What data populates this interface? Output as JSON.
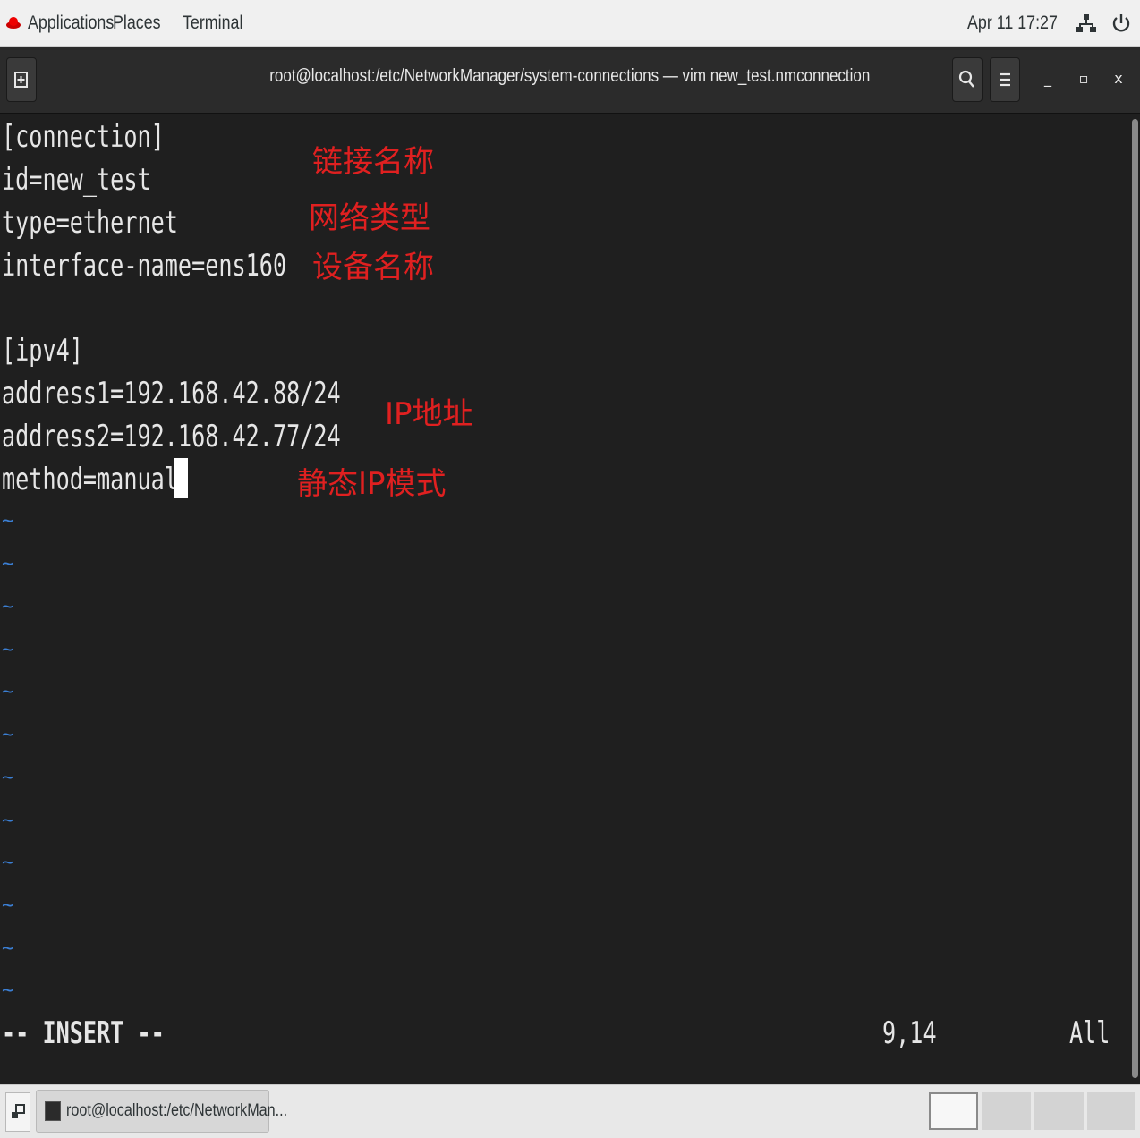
{
  "topbar": {
    "applications": "Applications",
    "places": "Places",
    "terminal": "Terminal",
    "clock": "Apr 11  17:27",
    "icons": [
      "redhat-logo-icon",
      "network-icon",
      "power-icon"
    ]
  },
  "window": {
    "title": "root@localhost:/etc/NetworkManager/system-connections — vim new_test.nmconnection",
    "buttons": [
      "new-tab-icon",
      "search-icon",
      "menu-icon",
      "minimize-icon",
      "maximize-icon",
      "close-icon"
    ],
    "minimize_glyph": "_",
    "maximize_glyph": "▫",
    "close_glyph": "x"
  },
  "editor": {
    "lines": [
      "[connection]",
      "id=new_test",
      "type=ethernet",
      "interface-name=ens160",
      "",
      "[ipv4]",
      "address1=192.168.42.88/24",
      "address2=192.168.42.77/24",
      "method=manual"
    ],
    "tilde": "~",
    "mode": "-- INSERT --",
    "position": "9,14",
    "scroll": "All"
  },
  "annotations": {
    "connection_name": "链接名称",
    "network_type": "网络类型",
    "device_name": "设备名称",
    "ip_address": "IP地址",
    "static_ip_mode": "静态IP模式",
    "color": "#e02020"
  },
  "taskbar": {
    "task_label": "root@localhost:/etc/NetworkMan..."
  }
}
